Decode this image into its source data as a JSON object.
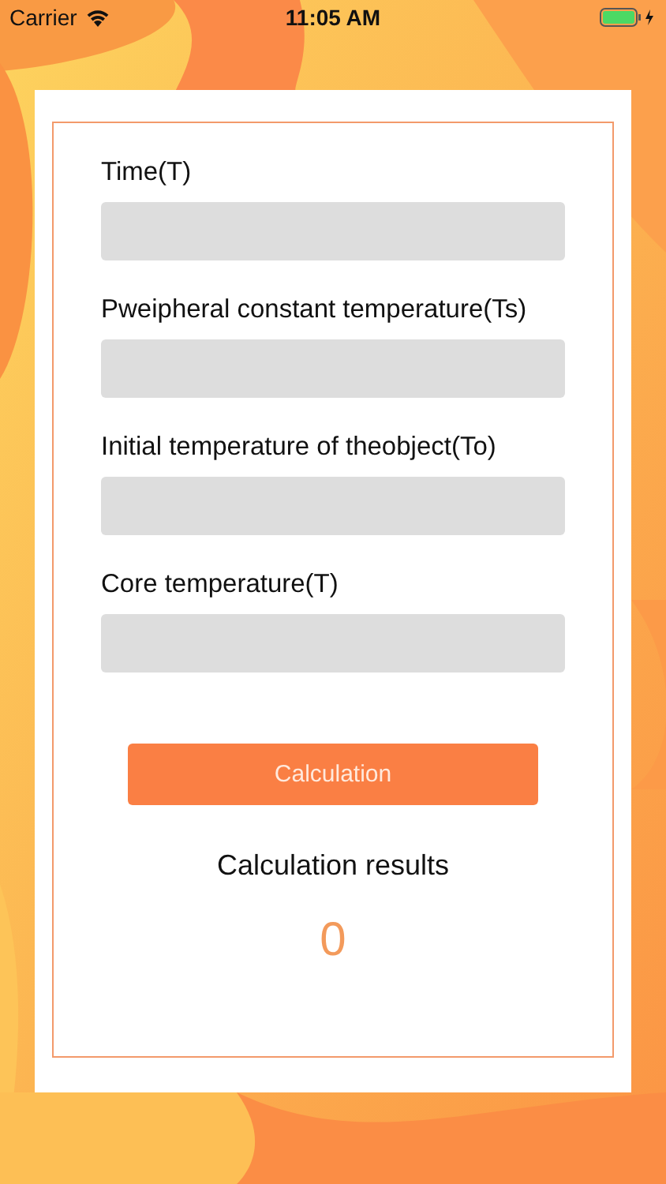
{
  "status_bar": {
    "carrier": "Carrier",
    "time": "11:05 AM"
  },
  "fields": [
    {
      "label": "Time(T)"
    },
    {
      "label": "Pweipheral constant temperature(Ts)"
    },
    {
      "label": "Initial temperature of theobject(To)"
    },
    {
      "label": "Core temperature(T)"
    }
  ],
  "button": "Calculation",
  "result": {
    "title": "Calculation results",
    "value": "0"
  }
}
